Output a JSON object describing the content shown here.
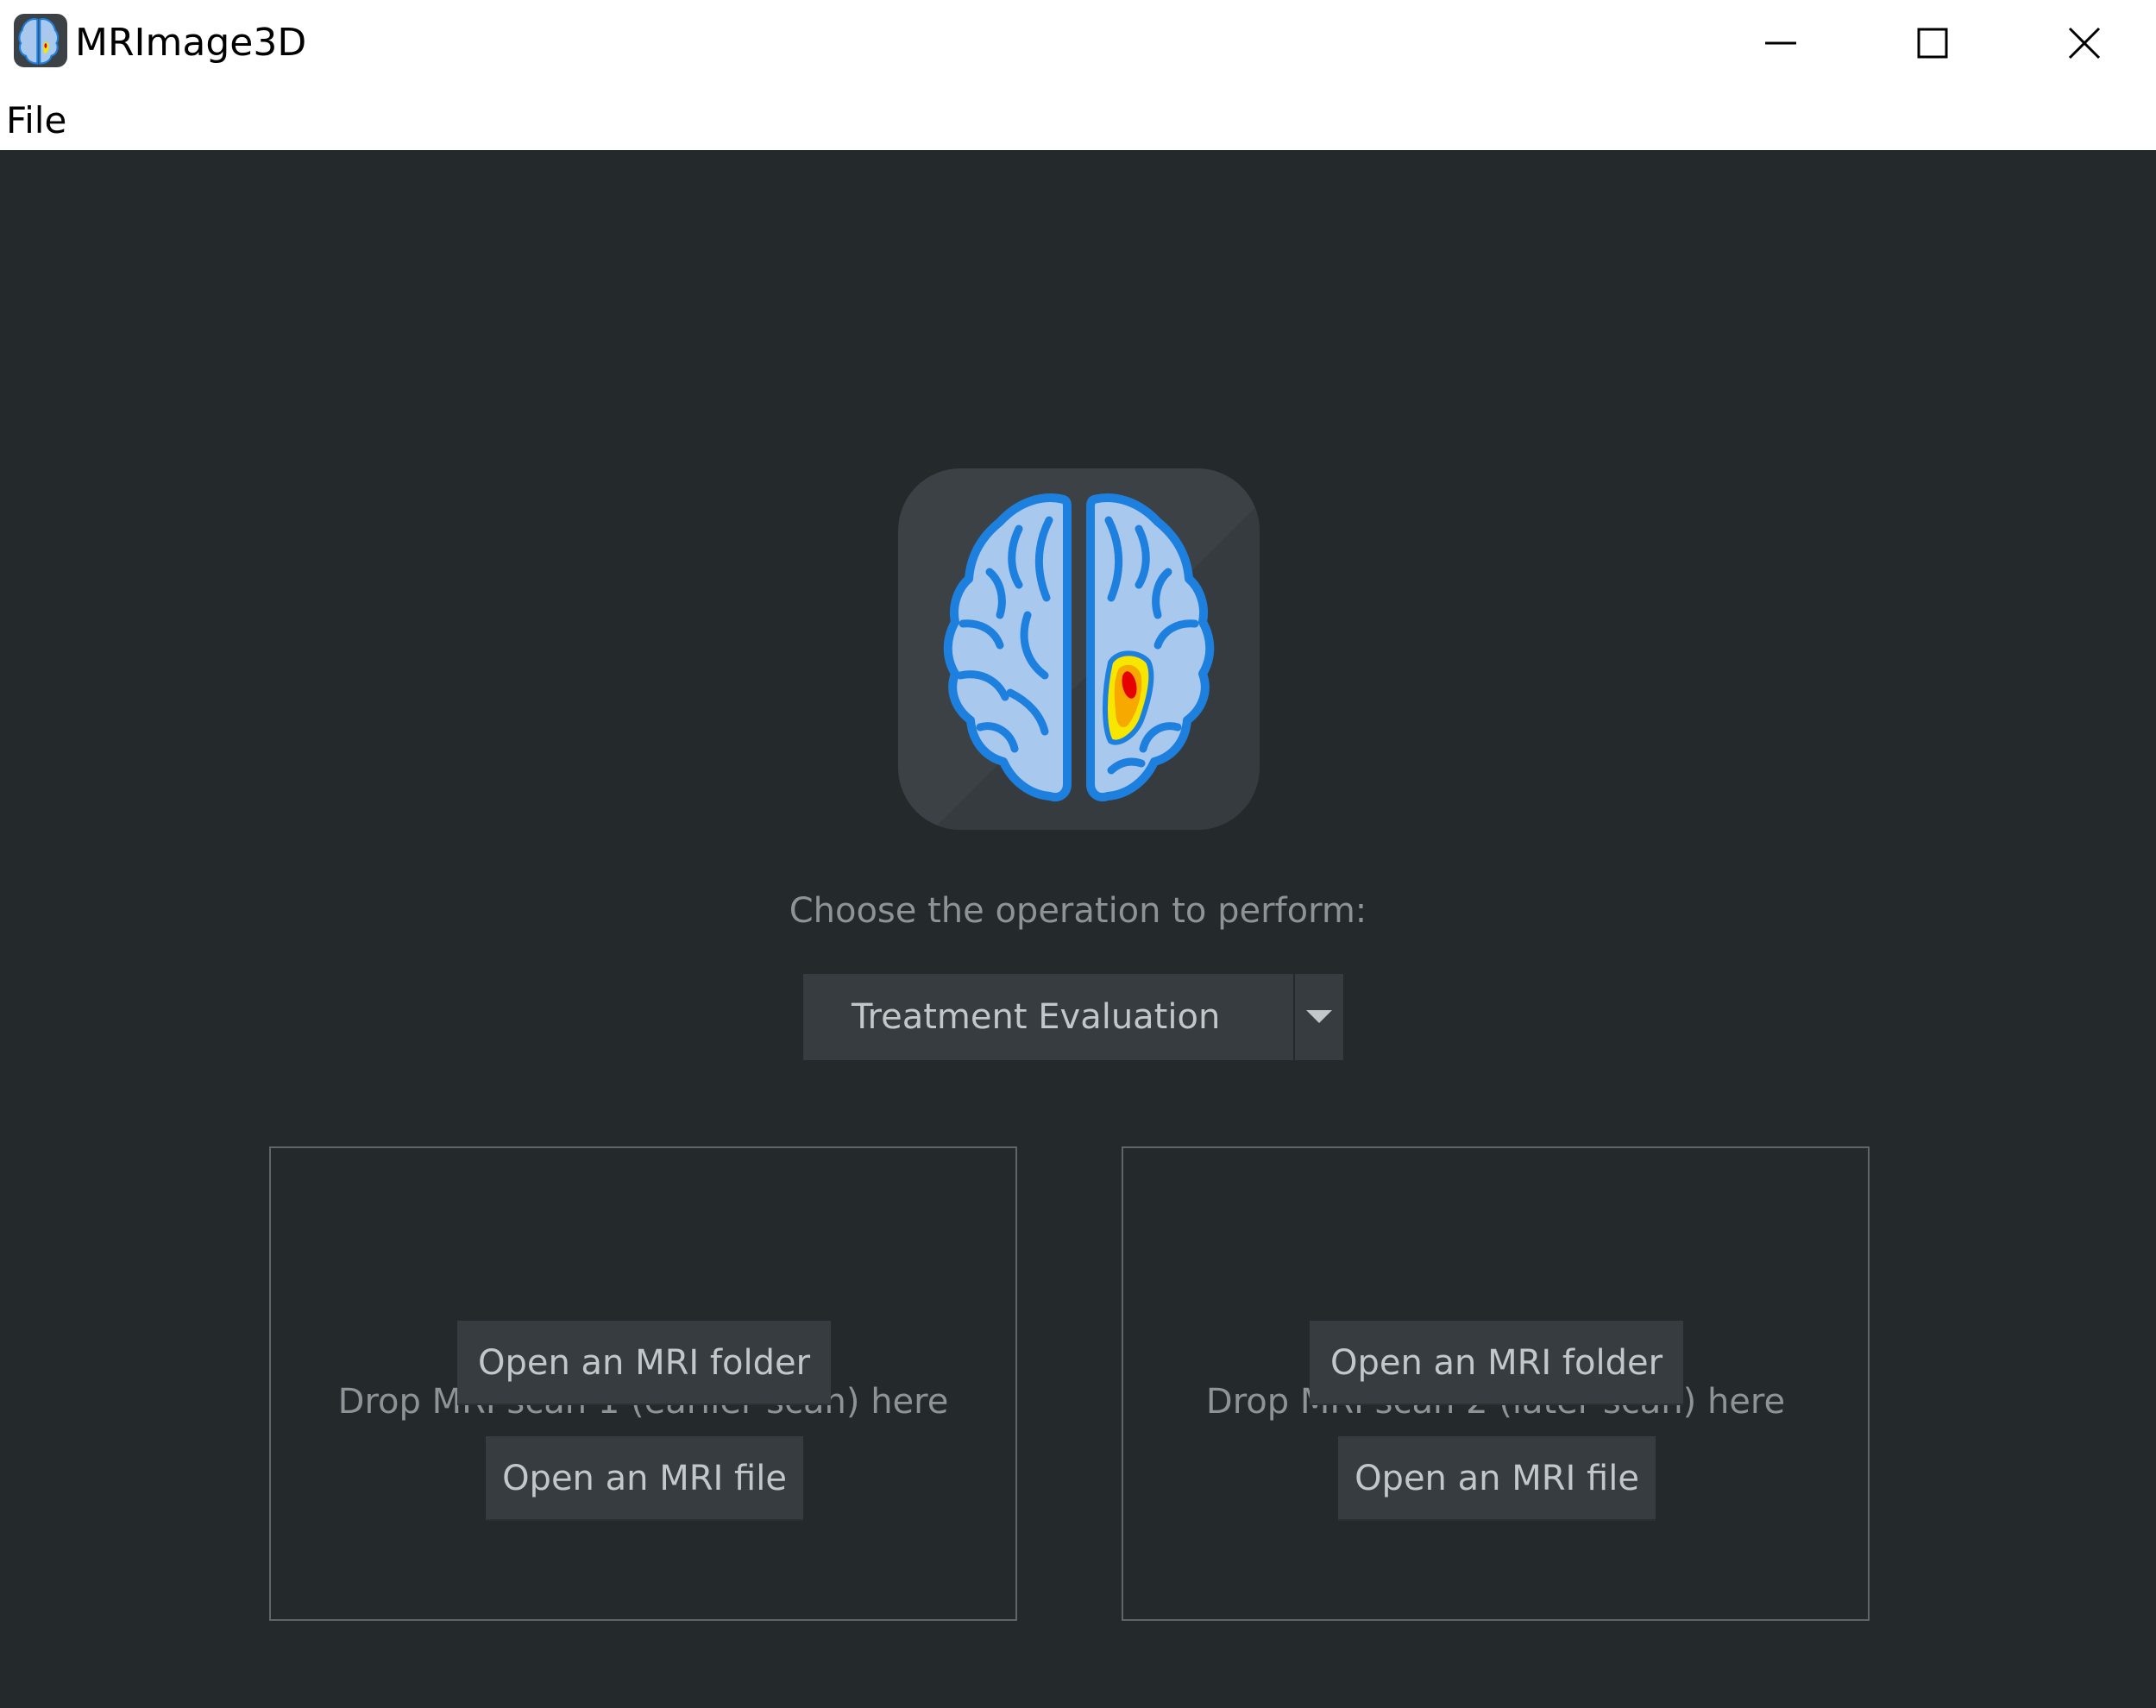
{
  "window": {
    "title": "MRImage3D",
    "icon": "brain-scan-icon"
  },
  "menu": {
    "items": [
      "File"
    ]
  },
  "main": {
    "logo_icon": "brain-scan-icon",
    "prompt": "Choose the operation to perform:",
    "operation_select": {
      "selected": "Treatment Evaluation"
    },
    "drop_zones": [
      {
        "label": "Drop MRI scan 1 (earlier scan) here",
        "open_folder_label": "Open an MRI folder",
        "open_file_label": "Open an MRI file"
      },
      {
        "label": "Drop MRI scan 2 (later scan) here",
        "open_folder_label": "Open an MRI folder",
        "open_file_label": "Open an MRI file"
      }
    ]
  },
  "colors": {
    "background": "#24292c",
    "panel": "#363c40",
    "text": "#c2c7ca",
    "muted_text": "#8d9396",
    "brain_fill": "#a8c8ee",
    "brain_stroke": "#1e80de",
    "heat_outer": "#f7e600",
    "heat_mid": "#f7a900",
    "heat_core": "#e60000"
  }
}
